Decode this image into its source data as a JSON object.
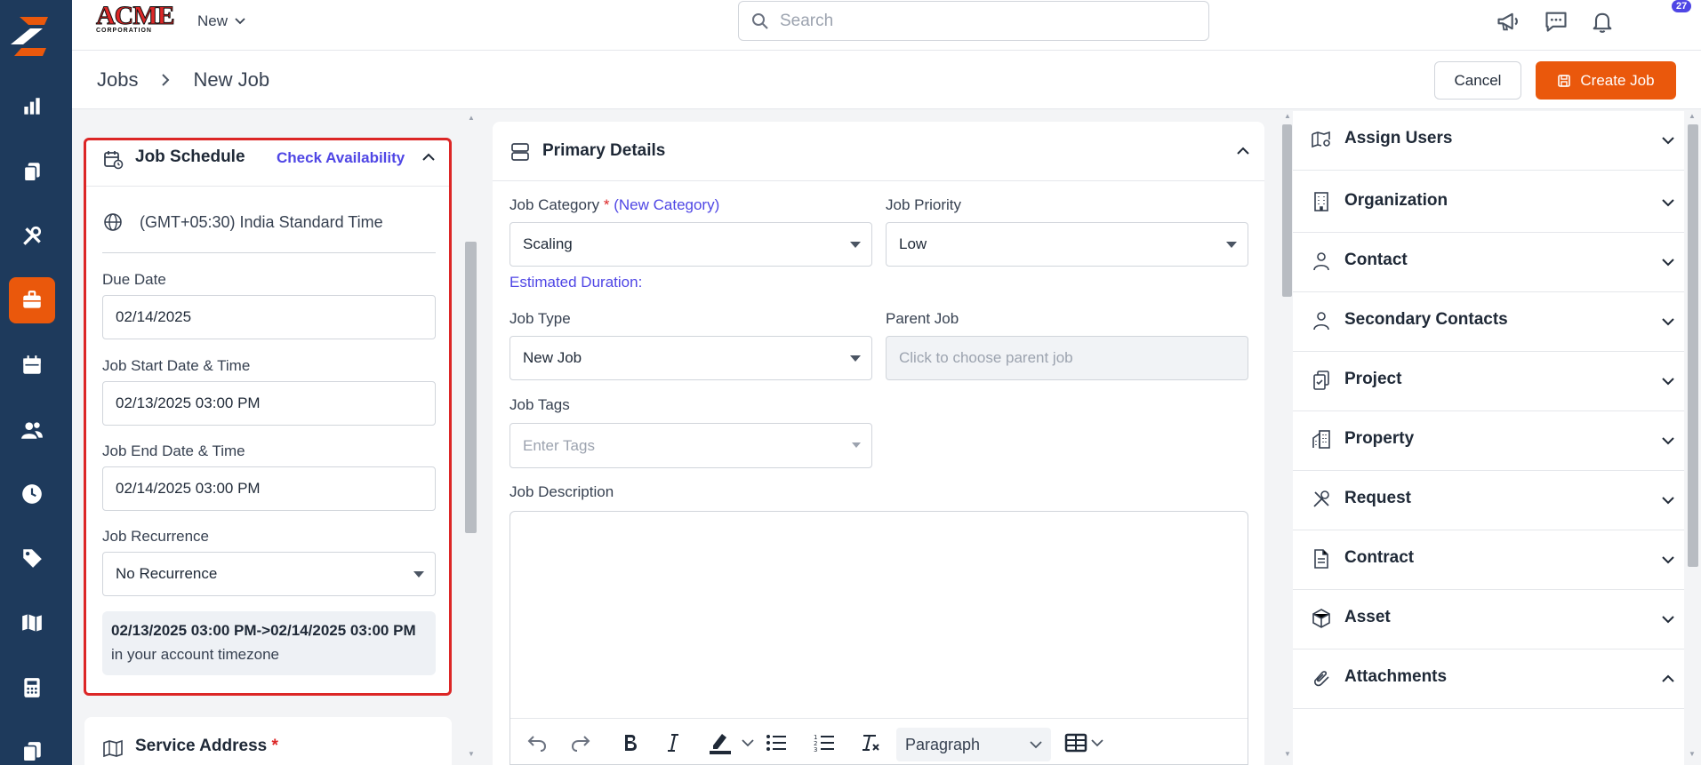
{
  "app": {
    "brand_main": "ACME",
    "brand_sub": "CORPORATION",
    "new_menu_label": "New",
    "search_placeholder": "Search",
    "notification_count": "27"
  },
  "sidebar": {
    "items": [
      "reports-icon",
      "jobs-copy-icon",
      "tools-icon",
      "briefcase-icon",
      "calendar-icon",
      "users-icon",
      "clock-icon",
      "tag-icon",
      "map-icon",
      "calculator-icon",
      "documents-icon"
    ],
    "active": "briefcase-icon"
  },
  "header": {
    "breadcrumb": [
      "Jobs",
      "New Job"
    ],
    "cancel_label": "Cancel",
    "create_label": "Create Job"
  },
  "schedule": {
    "title": "Job Schedule",
    "check_availability": "Check Availability",
    "timezone": "(GMT+05:30) India Standard Time",
    "due_date_label": "Due Date",
    "due_date_value": "02/14/2025",
    "start_label": "Job Start Date & Time",
    "start_value": "02/13/2025 03:00 PM",
    "end_label": "Job End Date & Time",
    "end_value": "02/14/2025 03:00 PM",
    "recurrence_label": "Job Recurrence",
    "recurrence_value": "No Recurrence",
    "summary_bold": "02/13/2025 03:00 PM->02/14/2025 03:00 PM",
    "summary_rest": " in your account timezone"
  },
  "service_address": {
    "title": "Service Address",
    "required_mark": "*"
  },
  "primary": {
    "title": "Primary Details",
    "category_label": "Job Category",
    "required_mark": "*",
    "new_category": "(New Category)",
    "category_value": "Scaling",
    "priority_label": "Job Priority",
    "priority_value": "Low",
    "estimated_duration": "Estimated Duration:",
    "type_label": "Job Type",
    "type_value": "New Job",
    "parent_label": "Parent Job",
    "parent_placeholder": "Click to choose parent job",
    "tags_label": "Job Tags",
    "tags_placeholder": "Enter Tags",
    "description_label": "Job Description",
    "paragraph_select": "Paragraph"
  },
  "right_panel": {
    "sections": [
      {
        "label": "Assign Users",
        "icon": "map-user-icon",
        "expanded": false
      },
      {
        "label": "Organization",
        "icon": "building-icon",
        "expanded": false
      },
      {
        "label": "Contact",
        "icon": "person-icon",
        "expanded": false
      },
      {
        "label": "Secondary Contacts",
        "icon": "person-icon",
        "expanded": false
      },
      {
        "label": "Project",
        "icon": "project-icon",
        "expanded": false
      },
      {
        "label": "Property",
        "icon": "property-icon",
        "expanded": false
      },
      {
        "label": "Request",
        "icon": "request-icon",
        "expanded": false
      },
      {
        "label": "Contract",
        "icon": "contract-icon",
        "expanded": false
      },
      {
        "label": "Asset",
        "icon": "box-icon",
        "expanded": false
      },
      {
        "label": "Attachments",
        "icon": "paperclip-icon",
        "expanded": true
      }
    ]
  },
  "colors": {
    "sidebar": "#1e3a5c",
    "accent": "#ea580c",
    "link": "#4f46e5",
    "highlight_border": "#dc2626"
  }
}
